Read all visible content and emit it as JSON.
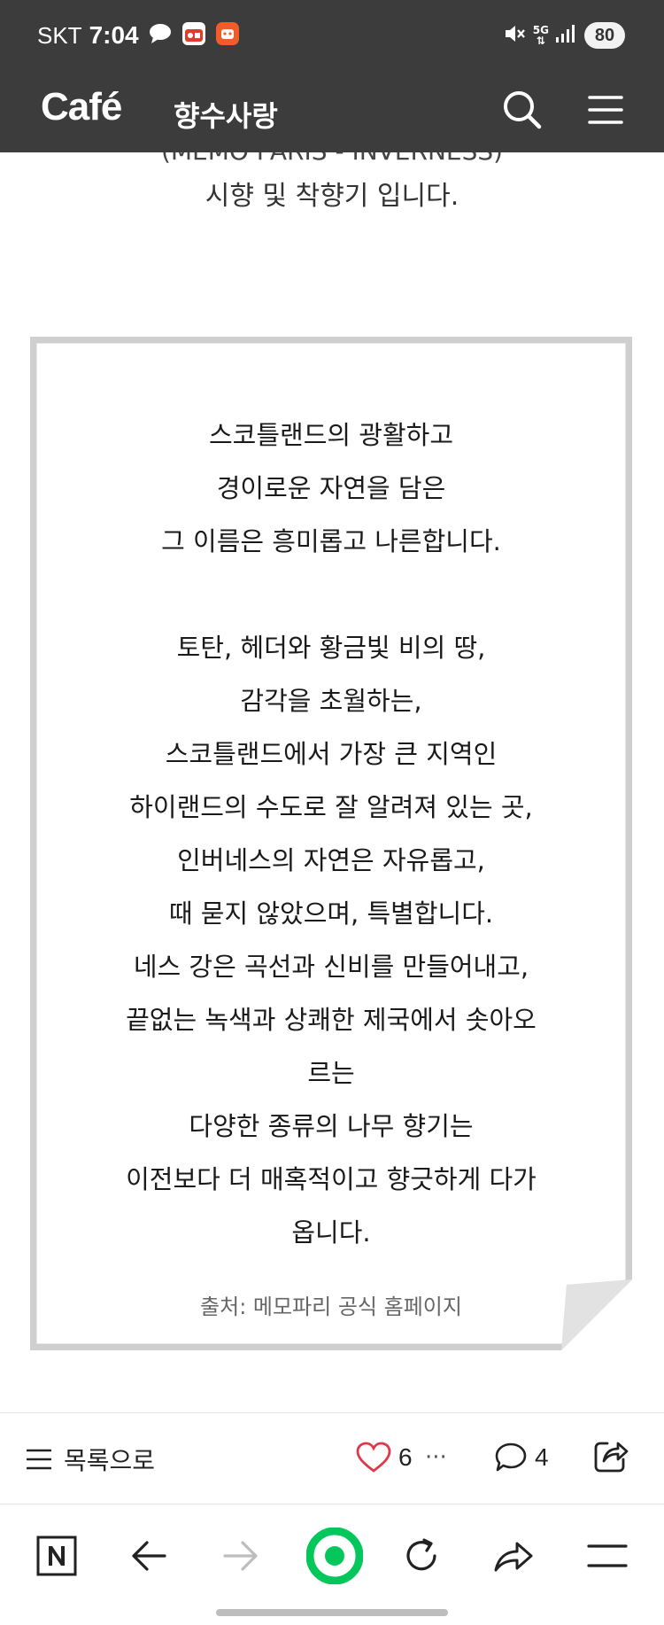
{
  "status_bar": {
    "carrier": "SKT",
    "time": "7:04",
    "network": "5G",
    "battery": "80"
  },
  "header": {
    "logo": "Café",
    "cafe_name": "향수사랑",
    "icons": [
      "search-icon",
      "menu-icon"
    ]
  },
  "article": {
    "intro_partial": "(MEMO PARIS - INVERNESS)",
    "intro_line": "시향 및 착향기 입니다.",
    "quote": {
      "stanza1": [
        "스코틀랜드의 광활하고",
        "경이로운 자연을 담은",
        "그 이름은 흥미롭고 나른합니다."
      ],
      "stanza2": [
        "토탄, 헤더와 황금빛 비의 땅,",
        "감각을 초월하는,",
        "스코틀랜드에서 가장 큰 지역인",
        "하이랜드의 수도로 잘 알려져 있는 곳,",
        "인버네스의 자연은 자유롭고,",
        "때 묻지 않았으며, 특별합니다.",
        "네스 강은 곡선과 신비를 만들어내고,",
        "끝없는 녹색과 상쾌한 제국에서 솟아오",
        "르는",
        "다양한 종류의 나무 향기는",
        "이전보다 더 매혹적이고 향긋하게 다가",
        "옵니다."
      ],
      "source": "출처: 메모파리 공식 홈페이지"
    }
  },
  "action_bar": {
    "list_label": "목록으로",
    "like_count": "6",
    "more": "···",
    "comment_count": "4",
    "like_color": "#e0384b"
  },
  "browser_bar": {
    "icons": [
      "naver-icon",
      "back-arrow-icon",
      "forward-arrow-icon",
      "green-dot-icon",
      "refresh-icon",
      "share-arrow-icon",
      "menu-icon"
    ],
    "accent": "#03c75a"
  }
}
